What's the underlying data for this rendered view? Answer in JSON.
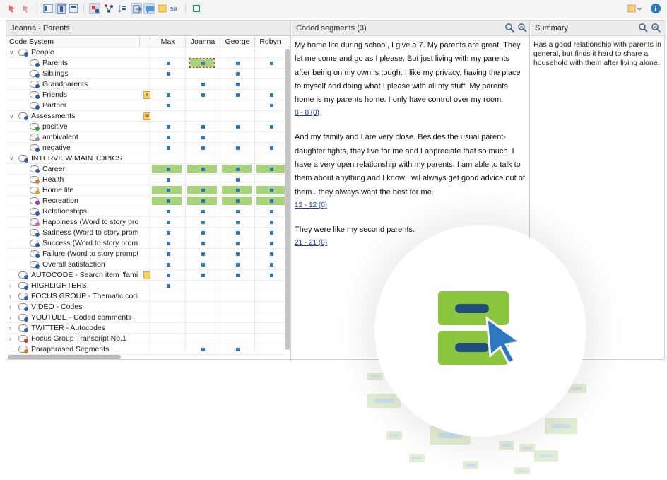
{
  "matrix": {
    "title": "Joanna - Parents",
    "code_system_label": "Code System",
    "columns": [
      "Max",
      "Joanna",
      "George",
      "Robyn"
    ],
    "rows": [
      {
        "label": "People",
        "level": 0,
        "twisty": "v",
        "color": "#2e5fa8"
      },
      {
        "label": "Parents",
        "level": 1,
        "color": "#2e5fa8"
      },
      {
        "label": "Siblings",
        "level": 1,
        "color": "#2e5fa8"
      },
      {
        "label": "Grandparents",
        "level": 1,
        "color": "#2e5fa8"
      },
      {
        "label": "Friends",
        "level": 1,
        "color": "#2e5fa8",
        "memo": "T"
      },
      {
        "label": "Partner",
        "level": 1,
        "color": "#2e5fa8"
      },
      {
        "label": "Assessments",
        "level": 0,
        "twisty": "v",
        "color": "#2e5fa8",
        "memo": "M"
      },
      {
        "label": "positive",
        "level": 1,
        "color": "#3aa33a"
      },
      {
        "label": "ambivalent",
        "level": 1,
        "color": "#9a9a9a"
      },
      {
        "label": "negative",
        "level": 1,
        "color": "#2e5fa8"
      },
      {
        "label": "INTERVIEW MAIN TOPICS",
        "level": 0,
        "twisty": "v",
        "color": "#2e5fa8"
      },
      {
        "label": "Career",
        "level": 1,
        "color": "#2e5fa8"
      },
      {
        "label": "Health",
        "level": 1,
        "color": "#e07d1a"
      },
      {
        "label": "Home life",
        "level": 1,
        "color": "#e0a21a"
      },
      {
        "label": "Recreation",
        "level": 1,
        "color": "#b036b0"
      },
      {
        "label": "Relationships",
        "level": 1,
        "color": "#2e5fa8"
      },
      {
        "label": "Happiness (Word to story prom",
        "level": 1,
        "color": "#e06a9a"
      },
      {
        "label": "Sadness (Word to story promp",
        "level": 1,
        "color": "#2e5fa8"
      },
      {
        "label": "Success (Word to story promp",
        "level": 1,
        "color": "#2e5fa8"
      },
      {
        "label": "Failure (Word to story prompts",
        "level": 1,
        "color": "#2e5fa8"
      },
      {
        "label": "Overall satisfaction",
        "level": 1,
        "color": "#2e5fa8"
      },
      {
        "label": "AUTOCODE - Search item \"family\"",
        "level": 0,
        "twisty": "",
        "color": "#2e5fa8",
        "memo": " "
      },
      {
        "label": "HIGHLIGHTERS",
        "level": 0,
        "twisty": ">",
        "color": "#2e5fa8"
      },
      {
        "label": "FOCUS GROUP - Thematic codes",
        "level": 0,
        "twisty": ">",
        "color": "#2e5fa8"
      },
      {
        "label": "VIDEO - Codes",
        "level": 0,
        "twisty": ">",
        "color": "#2e5fa8"
      },
      {
        "label": "YOUTUBE - Coded comments",
        "level": 0,
        "twisty": ">",
        "color": "#2e5fa8"
      },
      {
        "label": "TWITTER - Autocodes",
        "level": 0,
        "twisty": ">",
        "color": "#2e5fa8"
      },
      {
        "label": "Focus Group Transcript No.1",
        "level": 0,
        "twisty": ">",
        "color": "#c0392b"
      },
      {
        "label": "Paraphrased Segments",
        "level": 0,
        "twisty": "",
        "color": "#e07d1a"
      }
    ],
    "cells": [
      [
        0,
        0,
        0,
        0
      ],
      [
        1,
        2,
        1,
        1
      ],
      [
        1,
        0,
        1,
        0
      ],
      [
        0,
        1,
        1,
        0
      ],
      [
        1,
        1,
        1,
        1
      ],
      [
        1,
        0,
        0,
        1
      ],
      [
        0,
        0,
        0,
        0
      ],
      [
        1,
        1,
        1,
        1
      ],
      [
        1,
        1,
        0,
        0
      ],
      [
        1,
        1,
        1,
        1
      ],
      [
        0,
        0,
        0,
        0
      ],
      [
        3,
        3,
        3,
        3
      ],
      [
        1,
        0,
        1,
        0
      ],
      [
        3,
        3,
        3,
        3
      ],
      [
        3,
        3,
        3,
        3
      ],
      [
        1,
        1,
        1,
        1
      ],
      [
        1,
        1,
        1,
        1
      ],
      [
        1,
        1,
        1,
        1
      ],
      [
        1,
        1,
        1,
        1
      ],
      [
        1,
        1,
        1,
        1
      ],
      [
        1,
        1,
        1,
        1
      ],
      [
        1,
        1,
        1,
        1
      ],
      [
        1,
        0,
        0,
        0
      ],
      [
        0,
        0,
        0,
        0
      ],
      [
        0,
        0,
        0,
        0
      ],
      [
        0,
        0,
        0,
        0
      ],
      [
        0,
        0,
        0,
        0
      ],
      [
        0,
        0,
        0,
        0
      ],
      [
        0,
        1,
        1,
        0
      ]
    ]
  },
  "segments": {
    "title": "Coded segments (3)",
    "items": [
      {
        "text": "My home life during school, I give a 7. My parents are great. They let me come and go as I please. But just living with my parents after being on my own is tough. I like my privacy, having the place to myself and doing what I please with all my stuff. My parents home is my parents home. I only have control over my room.",
        "ref": "8 - 8  (0)"
      },
      {
        "text": "And my family and I are very close. Besides the usual parent-daughter fights, they live for me and I appreciate that so much. I have a very open relationship with my parents. I am able to talk to them about anything and I know I wil always get good advice out of them.. they always want the best for me.",
        "ref": "12 - 12  (0)"
      },
      {
        "text": "They were like my second parents.",
        "ref": "21 - 21  (0)"
      }
    ]
  },
  "summary": {
    "title": "Summary",
    "text": "Has a good relationship with parents in general, but finds it hard to share a household with them after living alone."
  },
  "colors": {
    "accent_green": "#8cc63f",
    "accent_navy": "#1f4e79",
    "accent_blue": "#2e78c0"
  },
  "icons": [
    "search-icon",
    "zoom-icon",
    "info-icon",
    "code-matrix-logo-icon",
    "cursor-arrow-icon"
  ]
}
